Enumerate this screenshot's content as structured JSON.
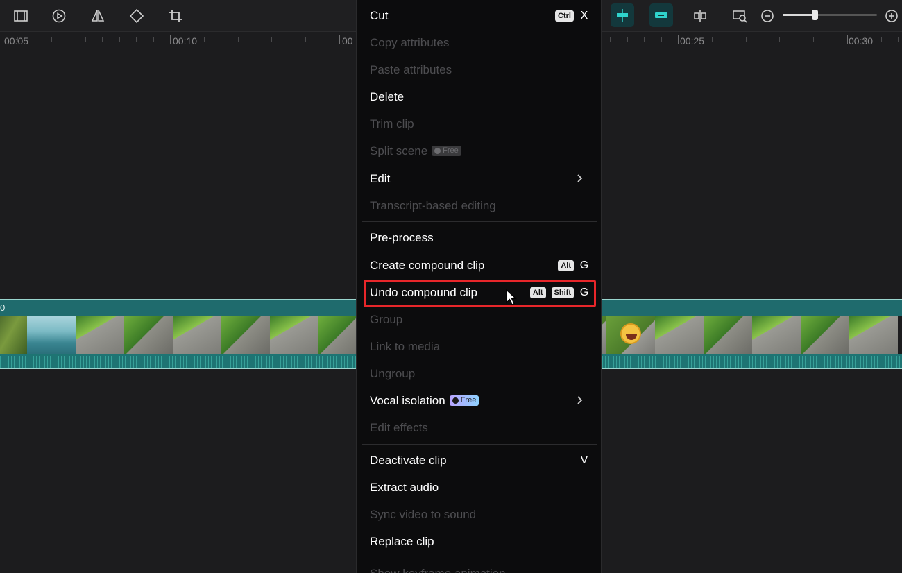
{
  "toolbar": {
    "left_icons": [
      "freeze-frame-icon",
      "play-circle-icon",
      "mirror-icon",
      "rotate-icon",
      "crop-icon"
    ],
    "right_icons": [
      "magnet-snap-icon",
      "link-clips-icon",
      "split-preview-icon",
      "preview-axis-icon",
      "zoom-out-icon",
      "zoom-in-icon"
    ],
    "zoom_level": 0.33,
    "accent_color": "#2fd3cc"
  },
  "ruler": {
    "labels": [
      "00:05",
      "00:10",
      "00",
      "00:25",
      "00:30"
    ]
  },
  "track": {
    "head_label": "0",
    "color": "#1f6b6d"
  },
  "menu": {
    "items": [
      {
        "label": "Cut",
        "enabled": true,
        "keys": [
          "Ctrl"
        ],
        "letter": "X"
      },
      {
        "label": "Copy attributes",
        "enabled": false
      },
      {
        "label": "Paste attributes",
        "enabled": false
      },
      {
        "label": "Delete",
        "enabled": true
      },
      {
        "label": "Trim clip",
        "enabled": false
      },
      {
        "label": "Split scene",
        "enabled": false,
        "badge": "Free"
      },
      {
        "label": "Edit",
        "enabled": true,
        "submenu": true
      },
      {
        "label": "Transcript-based editing",
        "enabled": false
      },
      {
        "label": "Pre-process",
        "enabled": true
      },
      {
        "label": "Create compound clip",
        "enabled": true,
        "keys": [
          "Alt"
        ],
        "letter": "G"
      },
      {
        "label": "Undo compound clip",
        "enabled": true,
        "keys": [
          "Alt",
          "Shift"
        ],
        "letter": "G",
        "highlighted": true
      },
      {
        "label": "Group",
        "enabled": false
      },
      {
        "label": "Link to media",
        "enabled": false
      },
      {
        "label": "Ungroup",
        "enabled": false
      },
      {
        "label": "Vocal isolation",
        "enabled": true,
        "badge": "Free",
        "submenu": true
      },
      {
        "label": "Edit effects",
        "enabled": false
      },
      {
        "label": "Deactivate clip",
        "enabled": true,
        "letter": "V"
      },
      {
        "label": "Extract audio",
        "enabled": true
      },
      {
        "label": "Sync video to sound",
        "enabled": false
      },
      {
        "label": "Replace clip",
        "enabled": true
      },
      {
        "label": "Show keyframe animation",
        "enabled": false
      }
    ],
    "highlight_color": "#e8262a"
  }
}
